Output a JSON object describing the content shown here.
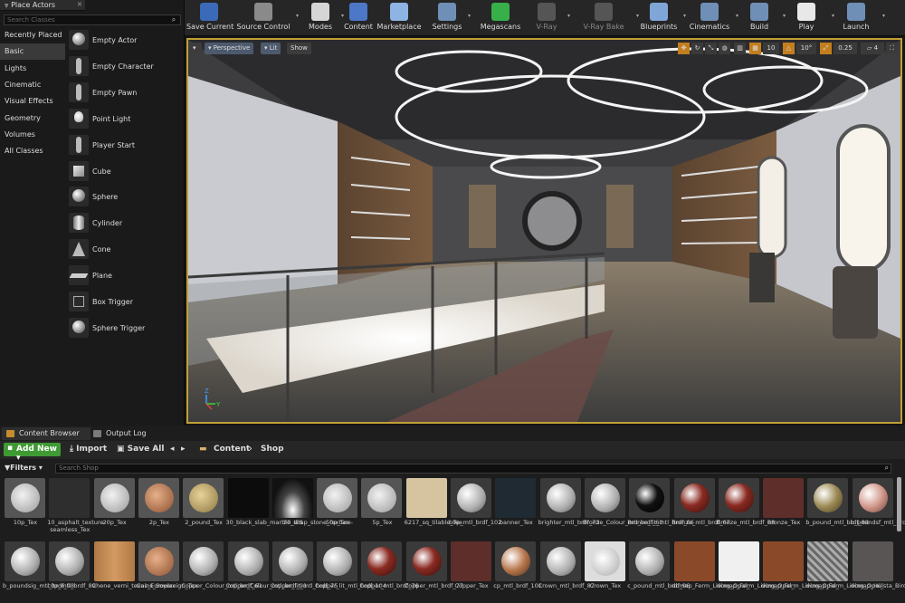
{
  "place_actors": {
    "tab_title": "Place Actors",
    "search_placeholder": "Search Classes",
    "categories": [
      "Recently Placed",
      "Basic",
      "Lights",
      "Cinematic",
      "Visual Effects",
      "Geometry",
      "Volumes",
      "All Classes"
    ],
    "active_category": "Basic",
    "items": [
      {
        "label": "Empty Actor",
        "icon": "sphere-icon"
      },
      {
        "label": "Empty Character",
        "icon": "character-icon"
      },
      {
        "label": "Empty Pawn",
        "icon": "pawn-icon"
      },
      {
        "label": "Point Light",
        "icon": "light-bulb-icon"
      },
      {
        "label": "Player Start",
        "icon": "player-start-icon"
      },
      {
        "label": "Cube",
        "icon": "cube-icon"
      },
      {
        "label": "Sphere",
        "icon": "sphere-icon"
      },
      {
        "label": "Cylinder",
        "icon": "cylinder-icon"
      },
      {
        "label": "Cone",
        "icon": "cone-icon"
      },
      {
        "label": "Plane",
        "icon": "plane-icon"
      },
      {
        "label": "Box Trigger",
        "icon": "box-trigger-icon"
      },
      {
        "label": "Sphere Trigger",
        "icon": "sphere-trigger-icon"
      }
    ]
  },
  "toolbar": {
    "buttons": [
      {
        "label": "Save Current",
        "icon": "save-icon",
        "color": "#3b6ab8"
      },
      {
        "label": "Source Control",
        "icon": "source-control-icon",
        "color": "#8a8a8a"
      },
      {
        "label": "Modes",
        "icon": "modes-icon",
        "color": "#d6d6d6"
      },
      {
        "label": "Content",
        "icon": "content-icon",
        "color": "#4d78c8"
      },
      {
        "label": "Marketplace",
        "icon": "marketplace-icon",
        "color": "#8db4e2"
      },
      {
        "label": "Settings",
        "icon": "settings-icon",
        "color": "#6f8fb6"
      },
      {
        "label": "Megascans",
        "icon": "megascans-icon",
        "color": "#37b04a"
      },
      {
        "label": "V-Ray",
        "icon": "vray-icon",
        "color": "#555555"
      },
      {
        "label": "V-Ray Bake",
        "icon": "vray-bake-icon",
        "color": "#555555"
      },
      {
        "label": "Blueprints",
        "icon": "blueprints-icon",
        "color": "#7fa6d6"
      },
      {
        "label": "Cinematics",
        "icon": "cinematics-icon",
        "color": "#6f8fb6"
      },
      {
        "label": "Build",
        "icon": "build-icon",
        "color": "#6f8fb6"
      },
      {
        "label": "Play",
        "icon": "play-icon",
        "color": "#e8e8e8"
      },
      {
        "label": "Launch",
        "icon": "launch-icon",
        "color": "#6f8fb6"
      }
    ]
  },
  "viewport": {
    "view_mode": "Perspective",
    "lit": "Lit",
    "show": "Show",
    "grid_size": "10",
    "rotation_snap": "10°",
    "scale_snap": "0.25",
    "camera_speed": "4"
  },
  "content_browser": {
    "tab_title": "Content Browser",
    "output_tab": "Output Log",
    "add_new": "Add New",
    "import": "Import",
    "save_all": "Save All",
    "breadcrumb": [
      "Content",
      "Shop"
    ],
    "filters": "Filters",
    "search_placeholder": "Search Shop",
    "assets_row1": [
      {
        "label": "10p_Tex",
        "kind": "coin-silver"
      },
      {
        "label": "10_asphalt_texture-seamless_Tex",
        "kind": "asphalt"
      },
      {
        "label": "20p_Tex",
        "kind": "coin-silver"
      },
      {
        "label": "2p_Tex",
        "kind": "coin-copper"
      },
      {
        "label": "2_pound_Tex",
        "kind": "coin-gold"
      },
      {
        "label": "30_black_slab_marble_soap_stone_texture-",
        "kind": "black"
      },
      {
        "label": "30_IES",
        "kind": "ies"
      },
      {
        "label": "50p_Tex",
        "kind": "coin-silver"
      },
      {
        "label": "5p_Tex",
        "kind": "coin-silver"
      },
      {
        "label": "6217_sq_tilable_Tex",
        "kind": "sand"
      },
      {
        "label": "b0p_mtl_brdf_102",
        "kind": "mat-white"
      },
      {
        "label": "banner_Tex",
        "kind": "banner"
      },
      {
        "label": "brighter_mtl_brdf_73",
        "kind": "mat-white"
      },
      {
        "label": "Bronze_Colour_mtl_brdf_60",
        "kind": "mat-white"
      },
      {
        "label": "Bronze_lit_mtl_brdf_66",
        "kind": "mat-black"
      },
      {
        "label": "Bronze_mtl_brdf_67",
        "kind": "mat-red"
      },
      {
        "label": "Bronze_mtl_brdf_68",
        "kind": "mat-red"
      },
      {
        "label": "Bronze_Tex",
        "kind": "flat-maroon"
      },
      {
        "label": "b_pound_mtl_brdf_88",
        "kind": "mat-gold"
      },
      {
        "label": "b_poundsf_mtl_brdf_97",
        "kind": "mat-pink"
      }
    ],
    "assets_row2": [
      {
        "label": "b_poundsig_mtl_brdf_98",
        "kind": "mat-white"
      },
      {
        "label": "c0p_mtl_brdf_89",
        "kind": "mat-white"
      },
      {
        "label": "Chene_verni_texas_Europlac",
        "kind": "wood"
      },
      {
        "label": "Coins_Sovereign_Tex",
        "kind": "coin-copper"
      },
      {
        "label": "Copper_Colour_mtl_brdf_61",
        "kind": "mat-white"
      },
      {
        "label": "Copper_Colour_mtl_brdf_91",
        "kind": "mat-white"
      },
      {
        "label": "Copper_lit_mtl_brdf_75",
        "kind": "mat-white"
      },
      {
        "label": "Copper_lit_mtl_brdf_104",
        "kind": "mat-white"
      },
      {
        "label": "Copper_mtl_brdf_76",
        "kind": "mat-red"
      },
      {
        "label": "Copper_mtl_brdf_77",
        "kind": "mat-red"
      },
      {
        "label": "Copper_Tex",
        "kind": "flat-maroon"
      },
      {
        "label": "cp_mtl_brdf_101",
        "kind": "mat-copper"
      },
      {
        "label": "Crown_mtl_brdf_87",
        "kind": "mat-white"
      },
      {
        "label": "Crown_Tex",
        "kind": "coin-white"
      },
      {
        "label": "c_pound_mtl_brdf_96",
        "kind": "mat-white"
      },
      {
        "label": "dcmap_Ferm_Living_Opal_",
        "kind": "leather"
      },
      {
        "label": "dcmap_Ferm_Living_Opal_",
        "kind": "white"
      },
      {
        "label": "dcmap_Ferm_Living_Opal_",
        "kind": "leather"
      },
      {
        "label": "dcmap_Ferm_Living_Opal_",
        "kind": "weave"
      },
      {
        "label": "dcmap_Hulsta_Birdy_Pouf_",
        "kind": "fabric"
      }
    ]
  }
}
